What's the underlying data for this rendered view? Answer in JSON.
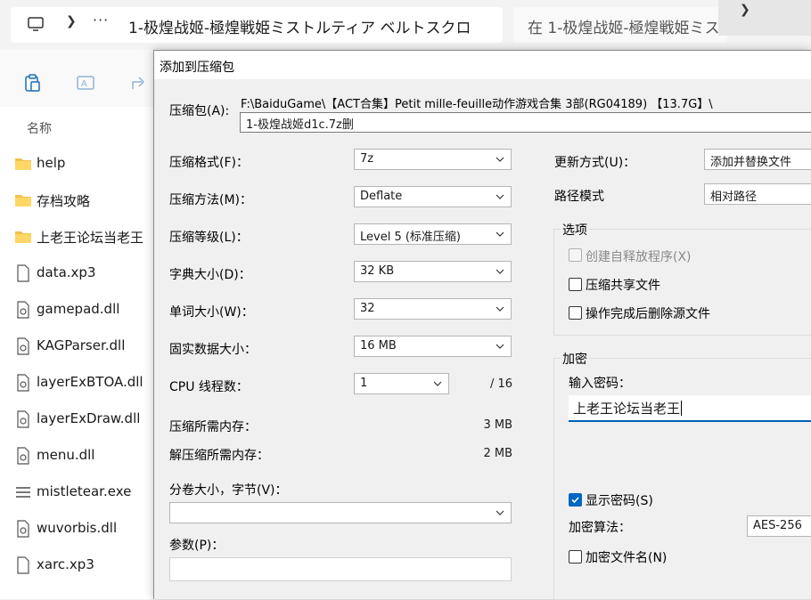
{
  "explorer": {
    "breadcrumb_text": "1-极煌战姬-極煌戦姫ミストルティア ベルトスクロ",
    "search_placeholder": "在 1-极煌战姬-極煌戦姫ミス",
    "column_name": "名称",
    "files": [
      {
        "name": "help",
        "icon": "folder-icon"
      },
      {
        "name": "存档攻略",
        "icon": "folder-icon"
      },
      {
        "name": "上老王论坛当老王",
        "icon": "folder-icon"
      },
      {
        "name": "data.xp3",
        "icon": "file-icon"
      },
      {
        "name": "gamepad.dll",
        "icon": "dll-file-icon"
      },
      {
        "name": "KAGParser.dll",
        "icon": "dll-file-icon"
      },
      {
        "name": "layerExBTOA.dll",
        "icon": "dll-file-icon"
      },
      {
        "name": "layerExDraw.dll",
        "icon": "dll-file-icon"
      },
      {
        "name": "menu.dll",
        "icon": "dll-file-icon"
      },
      {
        "name": "mistletear.exe",
        "icon": "exe-file-icon"
      },
      {
        "name": "wuvorbis.dll",
        "icon": "dll-file-icon"
      },
      {
        "name": "xarc.xp3",
        "icon": "file-icon"
      }
    ]
  },
  "dialog": {
    "title": "添加到压缩包",
    "archive_label": "压缩包(A):",
    "archive_path": "F:\\BaiduGame\\【ACT合集】Petit mille-feuille动作游戏合集 3部(RG04189) 【13.7G】\\",
    "archive_name": "1-极煌战姬d1c.7z删",
    "format_label": "压缩格式(F)：",
    "format_value": "7z",
    "method_label": "压缩方法(M)：",
    "method_value": "Deflate",
    "level_label": "压缩等级(L)：",
    "level_value": "Level 5 (标准压缩)",
    "dict_label": "字典大小(D)：",
    "dict_value": "32 KB",
    "word_label": "单词大小(W)：",
    "word_value": "32",
    "solid_label": "固实数据大小：",
    "solid_value": "16 MB",
    "cpu_label": "CPU 线程数：",
    "cpu_value": "1",
    "cpu_max": "/ 16",
    "mem_comp_label": "压缩所需内存：",
    "mem_comp_value": "3 MB",
    "mem_decomp_label": "解压缩所需内存：",
    "mem_decomp_value": "2 MB",
    "split_label": "分卷大小，字节(V)：",
    "split_value": "",
    "params_label": "参数(P)：",
    "params_value": "",
    "update_label": "更新方式(U)：",
    "update_value": "添加并替换文件",
    "path_mode_label": "路径模式",
    "path_mode_value": "相对路径",
    "options_title": "选项",
    "opt_sfx": "创建自释放程序(X)",
    "opt_shared": "压缩共享文件",
    "opt_delete": "操作完成后删除源文件",
    "encrypt_title": "加密",
    "password_label": "输入密码：",
    "password_value": "上老王论坛当老王",
    "show_password": "显示密码(S)",
    "enc_method_label": "加密算法：",
    "enc_method_value": "AES-256",
    "encrypt_names": "加密文件名(N)"
  }
}
